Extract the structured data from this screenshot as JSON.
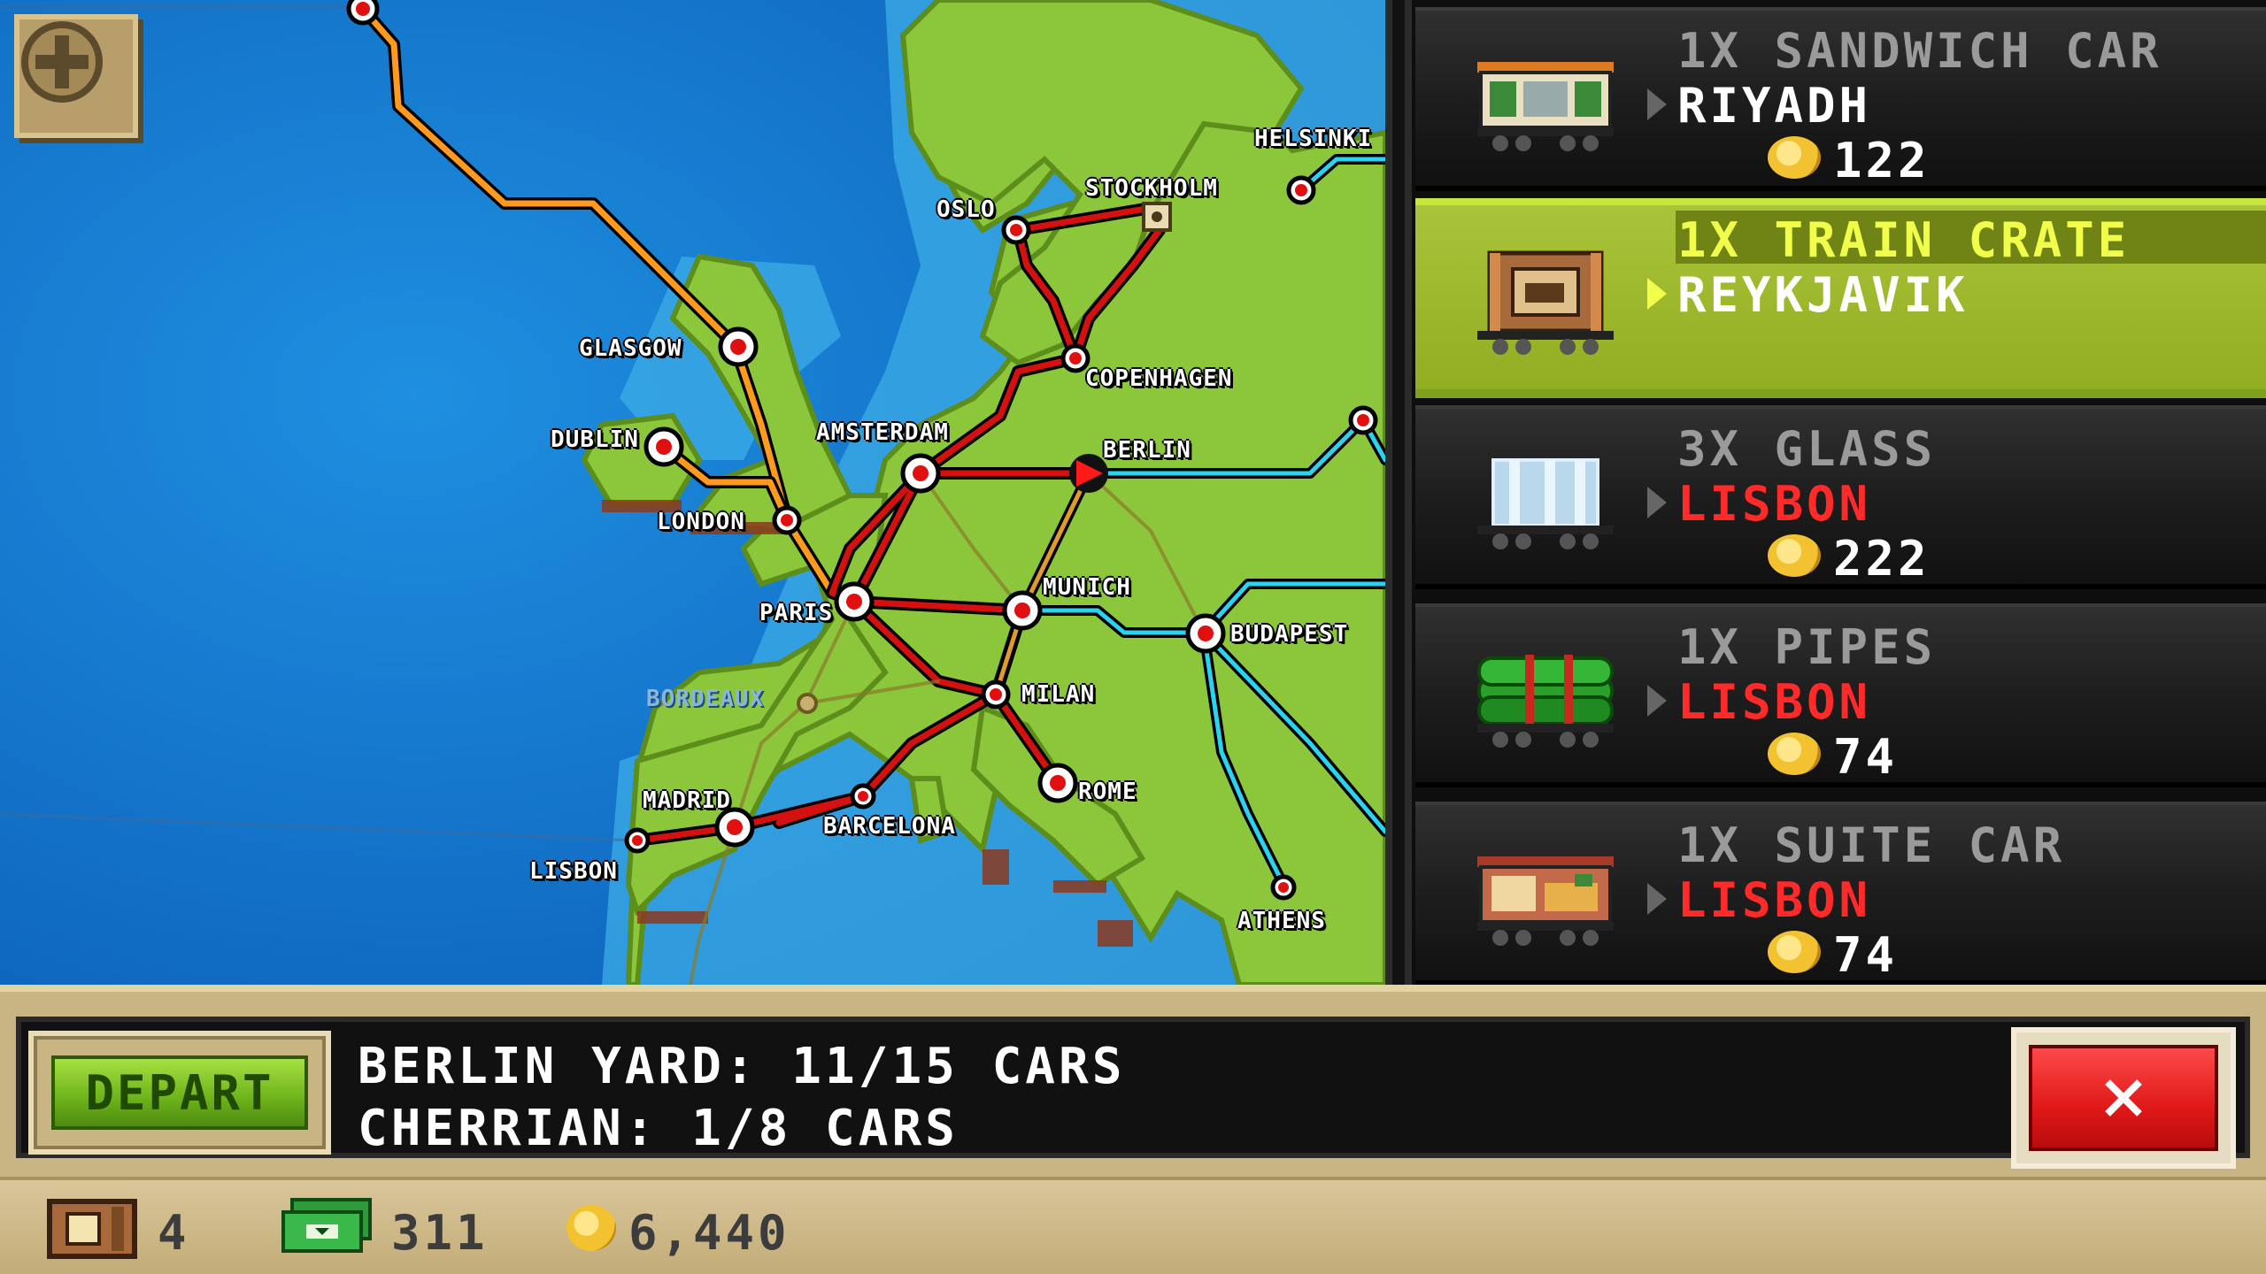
{
  "map": {
    "zoom_icon": "plus-icon",
    "cities": [
      {
        "key": "helsinki",
        "label": "HELSINKI"
      },
      {
        "key": "oslo",
        "label": "OSLO"
      },
      {
        "key": "stockholm",
        "label": "STOCKHOLM"
      },
      {
        "key": "glasgow",
        "label": "GLASGOW"
      },
      {
        "key": "copenhagen",
        "label": "COPENHAGEN"
      },
      {
        "key": "dublin",
        "label": "DUBLIN"
      },
      {
        "key": "amsterdam",
        "label": "AMSTERDAM"
      },
      {
        "key": "berlin",
        "label": "BERLIN"
      },
      {
        "key": "london",
        "label": "LONDON"
      },
      {
        "key": "munich",
        "label": "MUNICH"
      },
      {
        "key": "paris",
        "label": "PARIS"
      },
      {
        "key": "budapest",
        "label": "BUDAPEST"
      },
      {
        "key": "bordeaux",
        "label": "BORDEAUX"
      },
      {
        "key": "milan",
        "label": "MILAN"
      },
      {
        "key": "madrid",
        "label": "MADRID"
      },
      {
        "key": "rome",
        "label": "ROME"
      },
      {
        "key": "barcelona",
        "label": "BARCELONA"
      },
      {
        "key": "lisbon",
        "label": "LISBON"
      },
      {
        "key": "athens",
        "label": "ATHENS"
      }
    ]
  },
  "cargo": [
    {
      "qty": "1X SANDWICH CAR",
      "dest": "RIYADH",
      "price": "122",
      "dest_color": "white",
      "selected": false,
      "icon": "sandwich-car-icon"
    },
    {
      "qty": "1X TRAIN CRATE",
      "dest": "REYKJAVIK",
      "price": "",
      "dest_color": "white",
      "selected": true,
      "icon": "train-crate-icon"
    },
    {
      "qty": "3X GLASS",
      "dest": "LISBON",
      "price": "222",
      "dest_color": "red",
      "selected": false,
      "icon": "glass-car-icon"
    },
    {
      "qty": "1X PIPES",
      "dest": "LISBON",
      "price": "74",
      "dest_color": "red",
      "selected": false,
      "icon": "pipes-car-icon"
    },
    {
      "qty": "1X SUITE CAR",
      "dest": "LISBON",
      "price": "74",
      "dest_color": "red",
      "selected": false,
      "icon": "suite-car-icon"
    }
  ],
  "panel": {
    "depart_label": "DEPART",
    "yard_status": "BERLIN YARD: 11/15 CARS",
    "train_status": "CHERRIAN: 1/8 CARS",
    "close_icon": "close-icon"
  },
  "status": {
    "crates": "4",
    "cash": "311",
    "coins": "6,440"
  },
  "colors": {
    "selected_row": "#9bb52a",
    "destination_alert": "#ff2a2a",
    "depart_green": "#7cc21e",
    "close_red": "#e01818"
  }
}
